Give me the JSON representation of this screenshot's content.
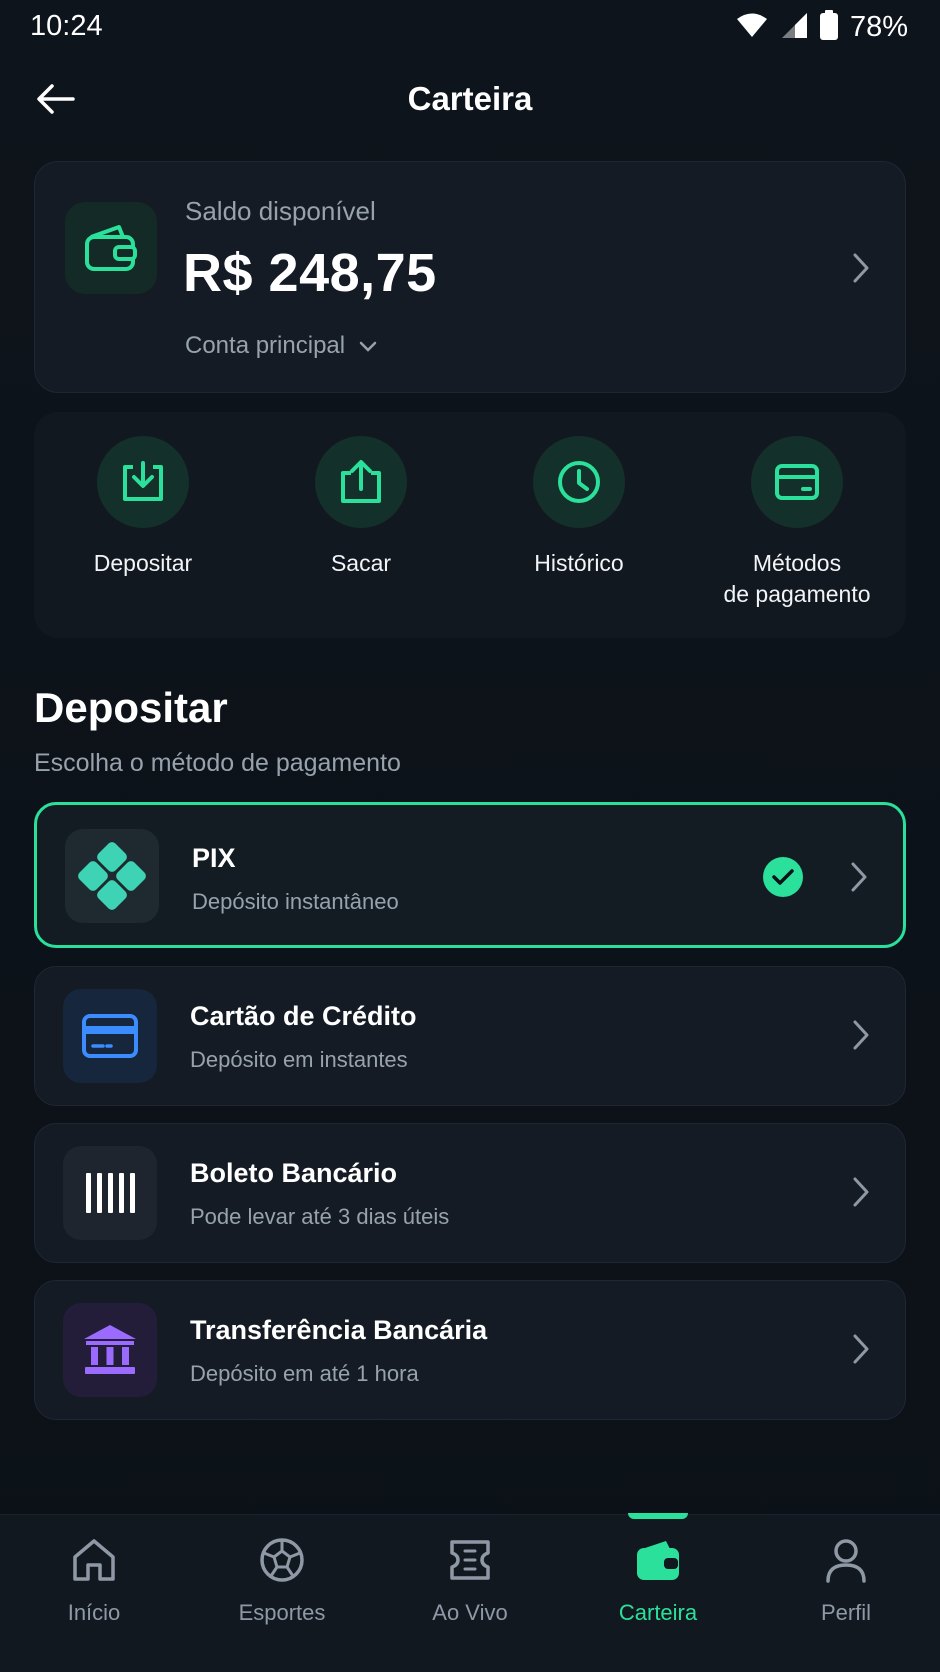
{
  "status_bar": {
    "time": "10:24",
    "battery": "78%",
    "icons": [
      "wifi-icon",
      "signal-icon",
      "battery-icon"
    ]
  },
  "header": {
    "title": "Carteira",
    "back_icon": "arrow-left-icon"
  },
  "balance": {
    "label": "Saldo disponível",
    "value": "R$ 248,75",
    "account": "Conta principal",
    "icon": "wallet-icon"
  },
  "actions": [
    {
      "label": "Depositar",
      "icon": "download-icon"
    },
    {
      "label": "Sacar",
      "icon": "upload-icon"
    },
    {
      "label": "Histórico",
      "icon": "clock-icon"
    },
    {
      "label_line1": "Métodos",
      "label_line2": "de pagamento",
      "icon": "card-icon"
    }
  ],
  "deposit": {
    "title": "Depositar",
    "subtitle": "Escolha o método de pagamento",
    "methods": [
      {
        "name": "PIX",
        "desc": "Depósito instantâneo",
        "icon": "pix-icon",
        "selected": true
      },
      {
        "name": "Cartão de Crédito",
        "desc": "Depósito em instantes",
        "icon": "credit-card-icon",
        "selected": false
      },
      {
        "name": "Boleto Bancário",
        "desc": "Pode levar até 3 dias úteis",
        "icon": "barcode-icon",
        "selected": false
      },
      {
        "name": "Transferência Bancária",
        "desc": "Depósito em até 1 hora",
        "icon": "bank-icon",
        "selected": false
      }
    ]
  },
  "nav": [
    {
      "label": "Início",
      "icon": "home-icon"
    },
    {
      "label": "Esportes",
      "icon": "soccer-ball-icon"
    },
    {
      "label": "Ao Vivo",
      "icon": "ticket-icon"
    },
    {
      "label": "Carteira",
      "icon": "wallet-icon",
      "active": true
    },
    {
      "label": "Perfil",
      "icon": "user-icon"
    }
  ],
  "colors": {
    "accent": "#2be09a",
    "background": "#0d1218",
    "card": "#141b24",
    "muted": "#98a2ad",
    "card_blue": "#3b8cff",
    "bank_purple": "#9b6bff"
  }
}
